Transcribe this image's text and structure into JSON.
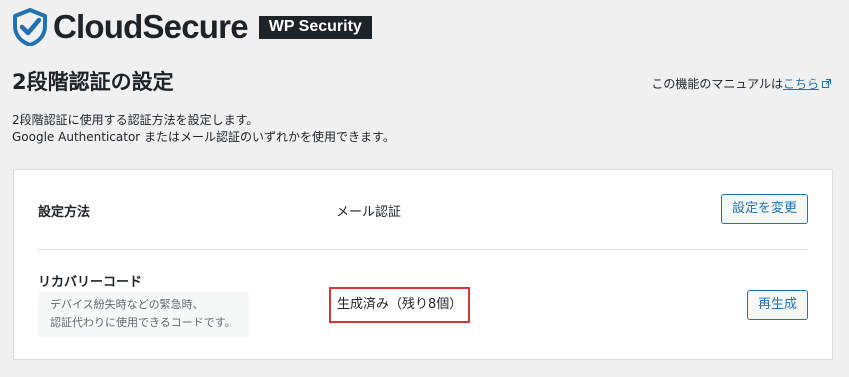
{
  "brand": {
    "name": "CloudSecure",
    "product": "WP Security"
  },
  "page": {
    "title": "2段階認証の設定"
  },
  "manual": {
    "prefix": "この機能のマニュアルは",
    "link": "こちら",
    "icon": "external-link-icon"
  },
  "description": {
    "line1": "2段階認証に使用する認証方法を設定します。",
    "line2": "Google Authenticator またはメール認証のいずれかを使用できます。"
  },
  "settings": {
    "method": {
      "label": "設定方法",
      "value": "メール認証",
      "button": "設定を変更"
    },
    "recovery": {
      "label": "リカバリーコード",
      "help_line1": "デバイス紛失時などの緊急時、",
      "help_line2": "認証代わりに使用できるコードです。",
      "status": "生成済み（残り8個）",
      "button": "再生成"
    }
  },
  "colors": {
    "background": "#f0f0f1",
    "text": "#1d2327",
    "accent": "#2271b1",
    "highlight_border": "#d63638",
    "logo": "#2271b1"
  }
}
